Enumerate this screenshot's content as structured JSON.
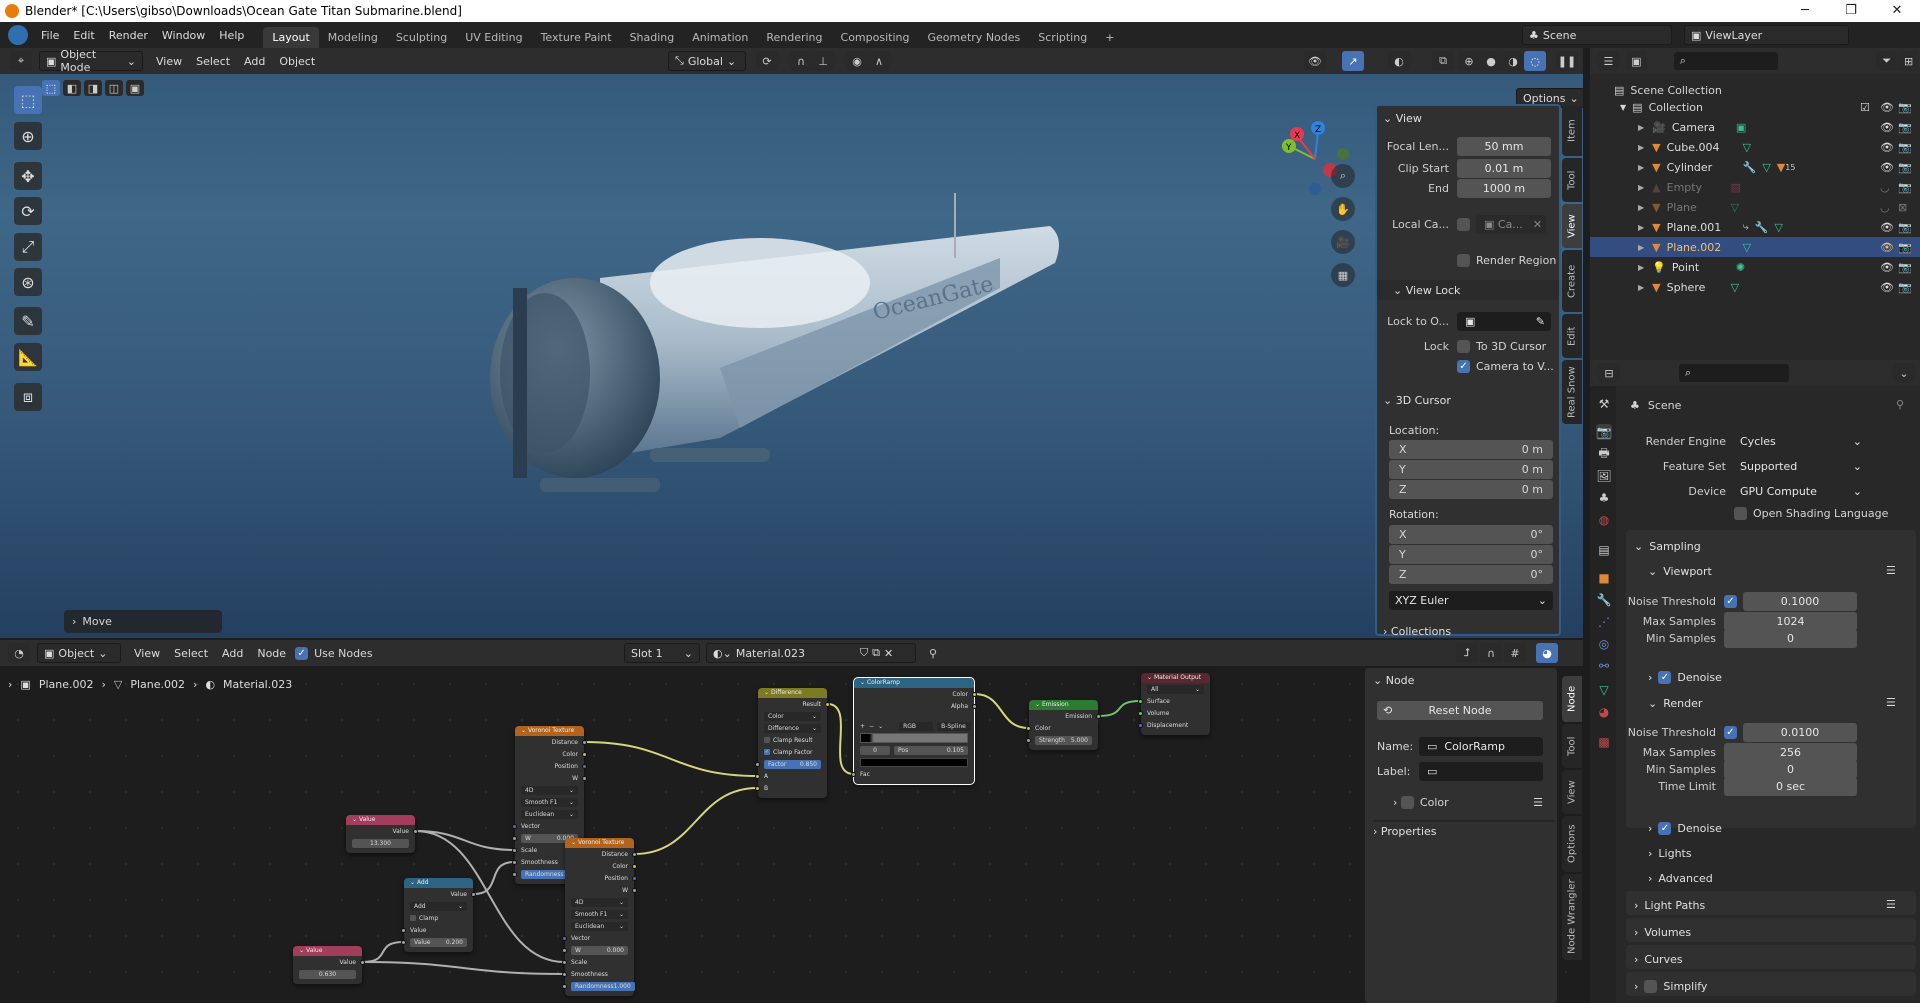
{
  "window": {
    "title": "Blender* [C:\\Users\\gibso\\Downloads\\Ocean Gate Titan Submarine.blend]",
    "controls": [
      "minimize",
      "maximize",
      "close"
    ]
  },
  "topbar": {
    "menus": [
      "File",
      "Edit",
      "Render",
      "Window",
      "Help"
    ],
    "workspaces": [
      "Layout",
      "Modeling",
      "Sculpting",
      "UV Editing",
      "Texture Paint",
      "Shading",
      "Animation",
      "Rendering",
      "Compositing",
      "Geometry Nodes",
      "Scripting",
      "+"
    ],
    "active_workspace": "Layout",
    "scene": "Scene",
    "view_layer": "ViewLayer"
  },
  "viewport": {
    "mode": "Object Mode",
    "menus": [
      "View",
      "Select",
      "Add",
      "Object"
    ],
    "orientation": "Global",
    "options": "Options",
    "last_operator": "Move",
    "tools": [
      "select-box",
      "cursor",
      "move",
      "rotate",
      "scale",
      "transform",
      "annotate",
      "measure",
      "add-cube"
    ],
    "active_tool": "select-box",
    "gizmo": {
      "x": "X",
      "y": "Y",
      "z": "Z"
    },
    "model_text": "OceanGate",
    "colors": {
      "x": "#e83a4f",
      "y": "#7fbf2e",
      "z": "#2f82e0"
    }
  },
  "npanel": {
    "tabs": [
      "Item",
      "Tool",
      "View",
      "Create",
      "Edit",
      "Real Snow"
    ],
    "active_tab": "View",
    "view": {
      "title": "View",
      "focal_label": "Focal Len...",
      "focal": "50 mm",
      "clip_start_label": "Clip Start",
      "clip_start": "0.01 m",
      "end_label": "End",
      "end": "1000 m",
      "local_cam_label": "Local Ca...",
      "local_cam": "Ca...",
      "render_region": "Render Region",
      "render_region_checked": false
    },
    "view_lock": {
      "title": "View Lock",
      "lock_to_label": "Lock to O...",
      "lock_label": "Lock",
      "to_cursor": "To 3D Cursor",
      "to_cursor_checked": false,
      "camera_to_view": "Camera to V...",
      "camera_to_view_checked": true
    },
    "cursor": {
      "title": "3D Cursor",
      "location_label": "Location:",
      "loc": [
        {
          "axis": "X",
          "value": "0 m"
        },
        {
          "axis": "Y",
          "value": "0 m"
        },
        {
          "axis": "Z",
          "value": "0 m"
        }
      ],
      "rotation_label": "Rotation:",
      "rot": [
        {
          "axis": "X",
          "value": "0°"
        },
        {
          "axis": "Y",
          "value": "0°"
        },
        {
          "axis": "Z",
          "value": "0°"
        }
      ],
      "mode": "XYZ Euler"
    },
    "collections": "Collections"
  },
  "outliner": {
    "scene_collection": "Scene Collection",
    "collection": "Collection",
    "items": [
      {
        "name": "Camera",
        "icon": "camera",
        "extras": [
          "camera-data"
        ],
        "dim": false,
        "selected": false
      },
      {
        "name": "Cube.004",
        "icon": "mesh",
        "extras": [
          "mesh-data"
        ],
        "dim": false,
        "selected": false
      },
      {
        "name": "Cylinder",
        "icon": "mesh",
        "extras": [
          "modifier",
          "mesh-data",
          "mesh-15"
        ],
        "dim": false,
        "selected": false
      },
      {
        "name": "Empty",
        "icon": "image-empty",
        "extras": [
          "image"
        ],
        "dim": true,
        "selected": false
      },
      {
        "name": "Plane",
        "icon": "mesh",
        "extras": [
          "mesh-data"
        ],
        "dim": true,
        "selected": false
      },
      {
        "name": "Plane.001",
        "icon": "mesh",
        "extras": [
          "curve-modifier",
          "modifier",
          "mesh-data"
        ],
        "dim": false,
        "selected": false
      },
      {
        "name": "Plane.002",
        "icon": "mesh",
        "extras": [
          "mesh-data"
        ],
        "dim": false,
        "selected": true
      },
      {
        "name": "Point",
        "icon": "light",
        "extras": [
          "light-data"
        ],
        "dim": false,
        "selected": false
      },
      {
        "name": "Sphere",
        "icon": "mesh",
        "extras": [
          "mesh-data"
        ],
        "dim": false,
        "selected": false
      }
    ],
    "badge_count": "15"
  },
  "properties": {
    "tabs": [
      "tool",
      "render",
      "output",
      "view-layer",
      "scene",
      "world",
      "collection",
      "object",
      "modifiers",
      "particles",
      "physics",
      "constraints",
      "data",
      "material",
      "texture"
    ],
    "active_tab": "render",
    "context": "Scene",
    "render_engine_label": "Render Engine",
    "render_engine": "Cycles",
    "feature_set_label": "Feature Set",
    "feature_set": "Supported",
    "device_label": "Device",
    "device": "GPU Compute",
    "osl": "Open Shading Language",
    "sampling": "Sampling",
    "viewport": {
      "title": "Viewport",
      "noise_label": "Noise Threshold",
      "noise": "0.1000",
      "max_label": "Max Samples",
      "max": "1024",
      "min_label": "Min Samples",
      "min": "0",
      "denoise": "Denoise"
    },
    "render": {
      "title": "Render",
      "noise_label": "Noise Threshold",
      "noise": "0.0100",
      "max_label": "Max Samples",
      "max": "256",
      "min_label": "Min Samples",
      "min": "0",
      "time_label": "Time Limit",
      "time": "0 sec",
      "denoise": "Denoise"
    },
    "lights": "Lights",
    "advanced": "Advanced",
    "light_paths": "Light Paths",
    "volumes": "Volumes",
    "curves": "Curves",
    "simplify": "Simplify"
  },
  "node_editor": {
    "type": "Object",
    "menus": [
      "View",
      "Select",
      "Add",
      "Node"
    ],
    "use_nodes": "Use Nodes",
    "slot": "Slot 1",
    "material": "Material.023",
    "breadcrumb": [
      "Plane.002",
      "Plane.002",
      "Material.023"
    ],
    "sidebar_tabs": [
      "Node",
      "Tool",
      "View",
      "Options",
      "Node Wrangler"
    ],
    "active_tab": "Node",
    "node_panel": {
      "title": "Node",
      "reset": "Reset Node",
      "name_label": "Name:",
      "name": "ColorRamp",
      "label_label": "Label:",
      "label": "",
      "color": "Color",
      "properties": "Properties"
    }
  },
  "nodes": [
    {
      "title": "Value",
      "color": "#a23d5c",
      "rows": [
        {
          "t": "out",
          "l": "Value",
          "s": "float"
        },
        {
          "t": "val",
          "v": "13.300"
        }
      ]
    },
    {
      "title": "Value",
      "color": "#a23d5c",
      "rows": [
        {
          "t": "out",
          "l": "Value",
          "s": "float"
        },
        {
          "t": "val",
          "v": "0.630"
        }
      ]
    },
    {
      "title": "Add",
      "color": "#2c6482",
      "rows": [
        {
          "t": "out",
          "l": "Value",
          "s": "float"
        },
        {
          "t": "drop",
          "v": "Add"
        },
        {
          "t": "chk",
          "l": "Clamp",
          "on": false
        },
        {
          "t": "in",
          "l": "Value",
          "s": "float"
        },
        {
          "t": "fin",
          "l": "Value",
          "v": "0.200",
          "s": "float"
        }
      ]
    },
    {
      "title": "Voronoi Texture",
      "color": "#b2641f",
      "rows": [
        {
          "t": "out",
          "l": "Distance",
          "s": "float"
        },
        {
          "t": "out",
          "l": "Color",
          "s": "color"
        },
        {
          "t": "out",
          "l": "Position",
          "s": "vector"
        },
        {
          "t": "out",
          "l": "W",
          "s": "float"
        },
        {
          "t": "drop",
          "v": "4D"
        },
        {
          "t": "drop",
          "v": "Smooth F1"
        },
        {
          "t": "drop",
          "v": "Euclidean"
        },
        {
          "t": "in",
          "l": "Vector",
          "s": "vector"
        },
        {
          "t": "fin",
          "l": "W",
          "v": "0.000",
          "s": "float"
        },
        {
          "t": "in",
          "l": "Scale",
          "s": "float"
        },
        {
          "t": "in",
          "l": "Smoothness",
          "s": "float"
        },
        {
          "t": "fin",
          "l": "Randomness",
          "v": "1.000",
          "s": "float",
          "blue": true
        }
      ]
    },
    {
      "title": "Voronoi Texture",
      "color": "#b2641f",
      "rows": [
        {
          "t": "out",
          "l": "Distance",
          "s": "float"
        },
        {
          "t": "out",
          "l": "Color",
          "s": "color"
        },
        {
          "t": "out",
          "l": "Position",
          "s": "vector"
        },
        {
          "t": "out",
          "l": "W",
          "s": "float"
        },
        {
          "t": "drop",
          "v": "4D"
        },
        {
          "t": "drop",
          "v": "Smooth F1"
        },
        {
          "t": "drop",
          "v": "Euclidean"
        },
        {
          "t": "in",
          "l": "Vector",
          "s": "vector"
        },
        {
          "t": "fin",
          "l": "W",
          "v": "0.000",
          "s": "float"
        },
        {
          "t": "in",
          "l": "Scale",
          "s": "float"
        },
        {
          "t": "in",
          "l": "Smoothness",
          "s": "float"
        },
        {
          "t": "fin",
          "l": "Randomness",
          "v": "1.000",
          "s": "float",
          "blue": true
        }
      ]
    },
    {
      "title": "Difference",
      "color": "#7c7a22",
      "rows": [
        {
          "t": "out",
          "l": "Result",
          "s": "color"
        },
        {
          "t": "drop",
          "v": "Color"
        },
        {
          "t": "drop",
          "v": "Difference"
        },
        {
          "t": "chk",
          "l": "Clamp Result",
          "on": false
        },
        {
          "t": "chk",
          "l": "Clamp Factor",
          "on": true
        },
        {
          "t": "fin",
          "l": "Factor",
          "v": "0.850",
          "s": "float",
          "blue": true
        },
        {
          "t": "in",
          "l": "A",
          "s": "color"
        },
        {
          "t": "in",
          "l": "B",
          "s": "color"
        }
      ]
    },
    {
      "title": "ColorRamp",
      "color": "#2c6482",
      "selected": true,
      "rows": [
        {
          "t": "out",
          "l": "Color",
          "s": "color"
        },
        {
          "t": "out",
          "l": "Alpha",
          "s": "float"
        },
        {
          "t": "rampctl",
          "mode": "RGB",
          "interp": "B-Spline"
        },
        {
          "t": "ramp"
        },
        {
          "t": "rampfld",
          "v": "0",
          "pos_label": "Pos",
          "pos": "0.105"
        },
        {
          "t": "swatch"
        },
        {
          "t": "in",
          "l": "Fac",
          "s": "float"
        }
      ]
    },
    {
      "title": "Emission",
      "color": "#2d7a33",
      "rows": [
        {
          "t": "out",
          "l": "Emission",
          "s": "shader"
        },
        {
          "t": "in",
          "l": "Color",
          "s": "color"
        },
        {
          "t": "fin",
          "l": "Strength",
          "v": "5.000",
          "s": "float"
        }
      ]
    },
    {
      "title": "Material Output",
      "color": "#5a2730",
      "rows": [
        {
          "t": "drop",
          "v": "All"
        },
        {
          "t": "in",
          "l": "Surface",
          "s": "shader"
        },
        {
          "t": "in",
          "l": "Volume",
          "s": "shader"
        },
        {
          "t": "in",
          "l": "Displacement",
          "s": "vector"
        }
      ]
    }
  ],
  "socket_colors": {
    "float": "#a1a1a1",
    "color": "#c7c729",
    "vector": "#6363c7",
    "shader": "#63c763"
  },
  "accent": "#4772b3"
}
